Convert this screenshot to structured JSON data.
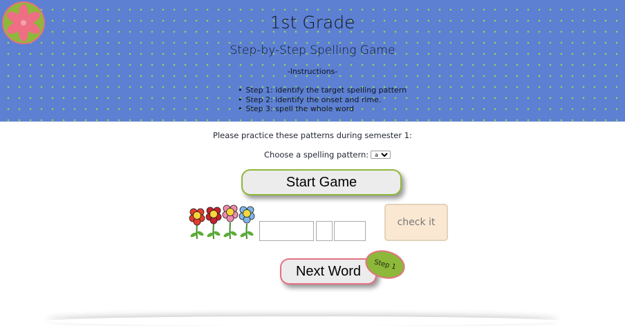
{
  "header": {
    "title": "1st Grade",
    "subtitle": "Step-by-Step Spelling Game",
    "instructions_heading": "-Instructions-",
    "steps": [
      "Step 1: identify the target spelling pattern",
      "Step 2: identify the onset and rime.",
      "Step 3: spell the whole word"
    ],
    "logo_icon": "flower-logo-icon"
  },
  "main": {
    "practice_text": "Please practice these patterns during semester 1:",
    "choose_label": "Choose a spelling pattern:",
    "pattern_select_value": "a",
    "start_button": "Start Game",
    "check_button": "check it",
    "next_button": "Next Word",
    "step_badge": "Step 1",
    "word_inputs": [
      "",
      "",
      ""
    ],
    "flower_icons": [
      "red-flower-icon",
      "red-flower-icon",
      "pink-flower-icon",
      "blue-flower-icon"
    ]
  },
  "colors": {
    "header_bg": "#5d80d2",
    "dots": "#9cd35a",
    "accent_green": "#8db83a",
    "accent_pink": "#e37083",
    "check_bg": "#fbe8d3"
  }
}
